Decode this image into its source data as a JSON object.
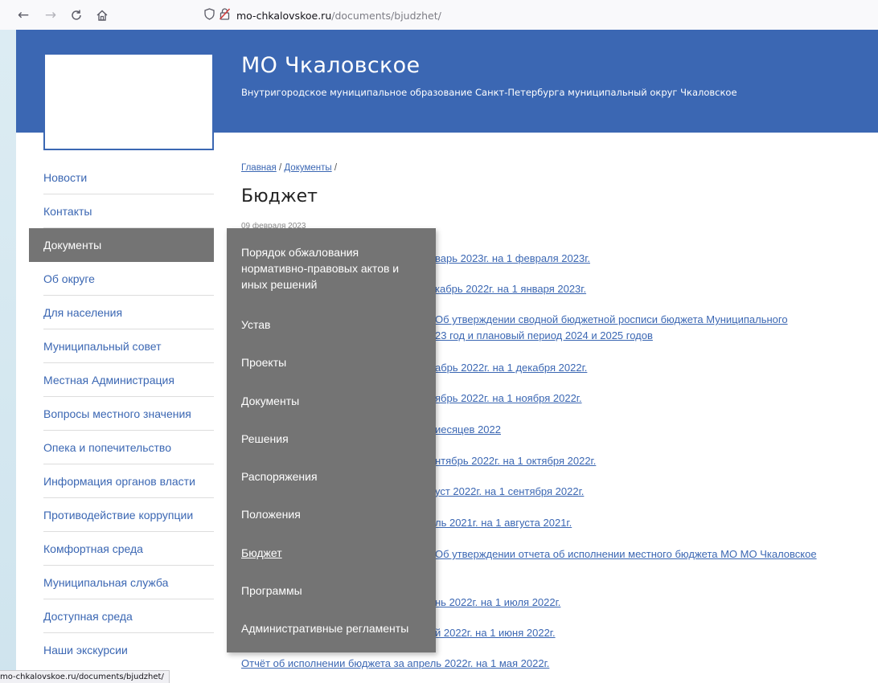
{
  "browser": {
    "back_icon": "←",
    "forward_icon": "→",
    "reload_icon": "C",
    "home_icon": "⌂",
    "url_host": "mo-chkalovskoe.ru",
    "url_path": "/documents/bjudzhet/"
  },
  "header": {
    "title": "МО Чкаловское",
    "subtitle": "Внутригородское муниципальное образование Санкт-Петербурга муниципальный округ Чкаловское",
    "bg_color": "#3b67b3"
  },
  "sidebar": {
    "items": [
      {
        "label": "Новости"
      },
      {
        "label": "Контакты"
      },
      {
        "label": "Документы"
      },
      {
        "label": "Об округе"
      },
      {
        "label": "Для населения"
      },
      {
        "label": "Муниципальный совет"
      },
      {
        "label": "Местная Администрация"
      },
      {
        "label": "Вопросы местного значения"
      },
      {
        "label": "Опека и попечительство"
      },
      {
        "label": "Информация органов власти"
      },
      {
        "label": "Противодействие коррупции"
      },
      {
        "label": "Комфортная среда"
      },
      {
        "label": "Муниципальная служба"
      },
      {
        "label": "Доступная среда"
      },
      {
        "label": "Наши экскурсии"
      }
    ],
    "active_index": 2
  },
  "breadcrumb": {
    "home": "Главная",
    "documents": "Документы",
    "sep": " / ",
    "trail_end": " /"
  },
  "page": {
    "title": "Бюджет",
    "date": "09 февраля 2023"
  },
  "documents": [
    "варь 2023г. на 1 февраля 2023г.",
    "кабрь 2022г. на 1 января 2023г.",
    "Об утверждении сводной бюджетной росписи бюджета Муниципального",
    "23 год и плановый период 2024 и 2025 годов",
    "абрь 2022г. на 1 декабря 2022г.",
    "ябрь 2022г. на 1 ноября 2022г.",
    "иесяцев 2022",
    "нтябрь 2022г. на 1 октября 2022г.",
    "уст 2022г. на 1 сентября 2022г.",
    "ль 2021г. на 1 августа 2021г.",
    "Об утверждении отчета об исполнении местного бюджета МО МО Чкаловское",
    "нь 2022г. на 1 июля 2022г.",
    "й 2022г. на 1 июня 2022г.",
    "Отчёт об исполнении бюджета за апрель 2022г. на 1 мая 2022г."
  ],
  "dropdown": {
    "items": [
      "Порядок обжалования нормативно-правовых актов и иных решений",
      "Устав",
      "Проекты",
      "Документы",
      "Решения",
      "Распоряжения",
      "Положения",
      "Бюджет",
      "Программы",
      "Административные регламенты"
    ],
    "current_index": 7
  },
  "status_bar": {
    "url": "mo-chkalovskoe.ru/documents/bjudzhet/"
  }
}
